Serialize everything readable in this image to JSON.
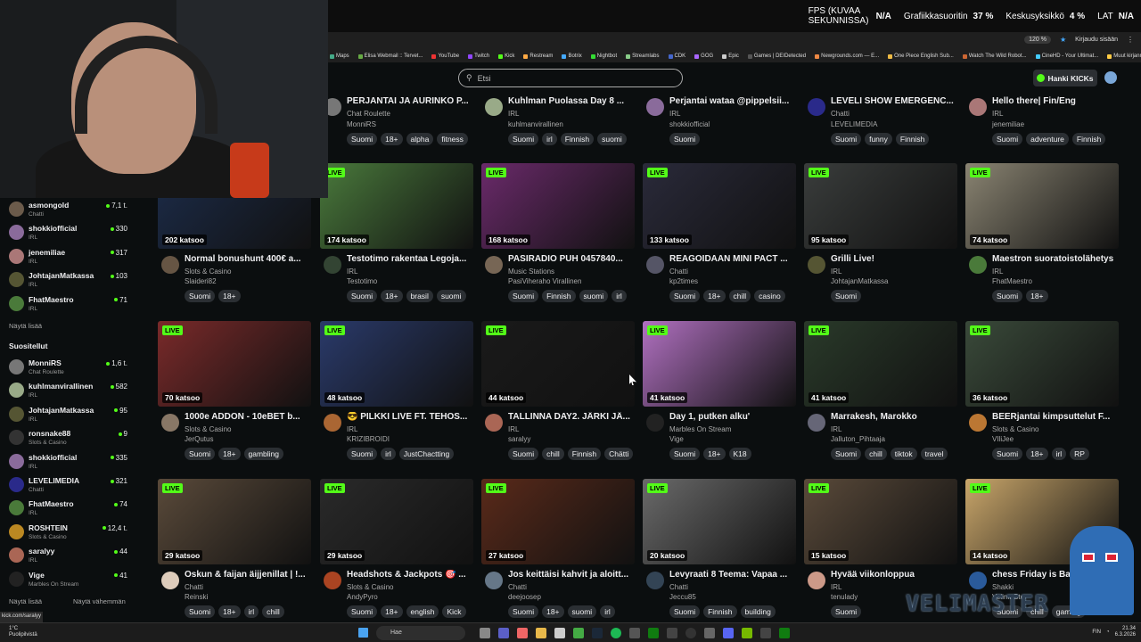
{
  "overlay": {
    "fps_label": "FPS (KUVAA SEKUNNISSA)",
    "fps_value": "N/A",
    "gpu_label": "Grafiikkasuoritin",
    "gpu_value": "37 %",
    "cpu_label": "Keskusyksikkö",
    "cpu_value": "4 %",
    "lat_label": "LAT",
    "lat_value": "N/A"
  },
  "browser": {
    "zoom": "120 %",
    "signin": "Kirjaudu sisään",
    "bookmarks": [
      "Maps",
      "Elisa Webmail :: Tervet...",
      "YouTube",
      "Twitch",
      "Kick",
      "Restream",
      "Botrix",
      "Nightbot",
      "Streamlabs",
      "CDK",
      "GOG",
      "Epic",
      "Games | DEIDetected",
      "Newgrounds.com — E...",
      "One Piece English Sub...",
      "Watch The Wild Robot...",
      "CineHD - Your Ultimat...",
      "Muut kirjanmerkit"
    ]
  },
  "header": {
    "search_placeholder": "Etsi",
    "kicks_button": "Hanki KICKs"
  },
  "sidebar": {
    "followed": [
      {
        "name": "asmongold",
        "cat": "Chatti",
        "views": "7,1 t.",
        "color": "#6b5b4b"
      },
      {
        "name": "shokkiofficial",
        "cat": "IRL",
        "views": "330",
        "color": "#8a6b9b"
      },
      {
        "name": "jenemiliae",
        "cat": "IRL",
        "views": "317",
        "color": "#a77"
      },
      {
        "name": "JohtajanMatkassa",
        "cat": "IRL",
        "views": "103",
        "color": "#553"
      },
      {
        "name": "FhatMaestro",
        "cat": "IRL",
        "views": "71",
        "color": "#4a7a3a"
      }
    ],
    "show_more": "Näytä lisää",
    "recommended_title": "Suositellut",
    "recommended": [
      {
        "name": "MonniRS",
        "cat": "Chat Roulette",
        "views": "1,6 t.",
        "color": "#777"
      },
      {
        "name": "kuhlmanvirallinen",
        "cat": "IRL",
        "views": "582",
        "color": "#9a8"
      },
      {
        "name": "JohtajanMatkassa",
        "cat": "IRL",
        "views": "95",
        "color": "#553"
      },
      {
        "name": "ronsnake88",
        "cat": "Slots & Casino",
        "views": "9",
        "color": "#333"
      },
      {
        "name": "shokkiofficial",
        "cat": "IRL",
        "views": "335",
        "color": "#8a6b9b"
      },
      {
        "name": "LEVELIMEDIA",
        "cat": "Chatti",
        "views": "321",
        "color": "#2a2a8a"
      },
      {
        "name": "FhatMaestro",
        "cat": "IRL",
        "views": "74",
        "color": "#4a7a3a"
      },
      {
        "name": "ROSHTEIN",
        "cat": "Slots & Casino",
        "views": "12,4 t.",
        "color": "#b82"
      },
      {
        "name": "saralyy",
        "cat": "IRL",
        "views": "44",
        "color": "#a65"
      },
      {
        "name": "Vige",
        "cat": "Marbles On Stream",
        "views": "41",
        "color": "#222"
      }
    ],
    "show_more2": "Näytä lisää",
    "show_less": "Näytä vähemmän",
    "status_url": "kick.com/saralyy"
  },
  "top_row": [
    {
      "title": "PERJANTAI JA AURINKO P...",
      "cat": "Chat Roulette",
      "user": "MonniRS",
      "tags": [
        "Suomi",
        "18+",
        "alpha",
        "fitness"
      ],
      "color": "#777"
    },
    {
      "title": "Kuhlman Puolassa Day 8 ...",
      "cat": "IRL",
      "user": "kuhlmanvirallinen",
      "tags": [
        "Suomi",
        "irl",
        "Finnish",
        "suomi"
      ],
      "color": "#9a8"
    },
    {
      "title": "Perjantai wataa @pippelsii...",
      "cat": "IRL",
      "user": "shokkiofficial",
      "tags": [
        "Suomi"
      ],
      "color": "#8a6b9b"
    },
    {
      "title": "LEVELI SHOW EMERGENC...",
      "cat": "Chatti",
      "user": "LEVELIMEDIA",
      "tags": [
        "Suomi",
        "funny",
        "Finnish"
      ],
      "color": "#2a2a8a"
    },
    {
      "title": "Hello there| Fin/Eng",
      "cat": "IRL",
      "user": "jenemiliae",
      "tags": [
        "Suomi",
        "adventure",
        "Finnish"
      ],
      "color": "#a77"
    }
  ],
  "rows": [
    [
      {
        "views": "202 katsoo",
        "title": "Normal bonushunt 400€ a...",
        "cat": "Slots & Casino",
        "user": "Slaideri82",
        "tags": [
          "Suomi",
          "18+"
        ],
        "bg": "#1c2c4a",
        "color": "#654"
      },
      {
        "views": "174 katsoo",
        "title": "Testotimo rakentaa Legoja...",
        "cat": "IRL",
        "user": "Testotimo",
        "tags": [
          "Suomi",
          "18+",
          "brasil",
          "suomi"
        ],
        "bg": "#4a7a3c",
        "color": "#343"
      },
      {
        "views": "168 katsoo",
        "title": "PASIRADIO PUH 0457840...",
        "cat": "Music Stations",
        "user": "PasiViheraho Virallinen",
        "tags": [
          "Suomi",
          "Finnish",
          "suomi",
          "irl"
        ],
        "bg": "#6a2a6a",
        "color": "#765"
      },
      {
        "views": "133 katsoo",
        "title": "REAGOIDAAN MINI PACT ...",
        "cat": "Chatti",
        "user": "kp2times",
        "tags": [
          "Suomi",
          "18+",
          "chill",
          "casino"
        ],
        "bg": "#2a2a3a",
        "color": "#556"
      },
      {
        "views": "95 katsoo",
        "title": "Grilli Live!",
        "cat": "IRL",
        "user": "JohtajanMatkassa",
        "tags": [
          "Suomi"
        ],
        "bg": "#3a3d3c",
        "color": "#553"
      },
      {
        "views": "74 katsoo",
        "title": "Maestron suoratoistolähetys",
        "cat": "IRL",
        "user": "FhatMaestro",
        "tags": [
          "Suomi",
          "18+"
        ],
        "bg": "#8a8472",
        "color": "#4a7a3a"
      }
    ],
    [
      {
        "views": "70 katsoo",
        "title": "1000e ADDON - 10eBET b...",
        "cat": "Slots & Casino",
        "user": "JerQutus",
        "tags": [
          "Suomi",
          "18+",
          "gambling"
        ],
        "bg": "#7a2a2a",
        "color": "#876"
      },
      {
        "views": "48 katsoo",
        "title": "😎 PILKKI LIVE FT. TEHOS...",
        "cat": "IRL",
        "user": "KRIZIBROIDI",
        "tags": [
          "Suomi",
          "irl",
          "JustChactting"
        ],
        "bg": "#2a3a6a",
        "color": "#a63"
      },
      {
        "views": "44 katsoo",
        "title": "TALLINNA DAY2. JÄRKI JÄ...",
        "cat": "IRL",
        "user": "saralyy",
        "tags": [
          "Suomi",
          "chill",
          "Finnish",
          "Chätti"
        ],
        "bg": "#1a1a1a",
        "color": "#a65"
      },
      {
        "views": "41 katsoo",
        "title": "Day 1, putken alku'",
        "cat": "Marbles On Stream",
        "user": "Vige",
        "tags": [
          "Suomi",
          "18+",
          "K18"
        ],
        "bg": "#b070c0",
        "color": "#222"
      },
      {
        "views": "41 katsoo",
        "title": "Marrakesh, Marokko",
        "cat": "IRL",
        "user": "Jalluton_Pihtaaja",
        "tags": [
          "Suomi",
          "chill",
          "tiktok",
          "travel"
        ],
        "bg": "#2a3a2a",
        "color": "#667"
      },
      {
        "views": "36 katsoo",
        "title": "BEERjantai kimpsuttelut F...",
        "cat": "Slots & Casino",
        "user": "VIliJee",
        "tags": [
          "Suomi",
          "18+",
          "irl",
          "RP"
        ],
        "bg": "#3a4a3a",
        "color": "#b73"
      }
    ],
    [
      {
        "views": "29 katsoo",
        "title": "Oskun & faijan äijjenillat | !...",
        "cat": "Chatti",
        "user": "Reinski",
        "tags": [
          "Suomi",
          "18+",
          "irl",
          "chill"
        ],
        "bg": "#5a4a3a",
        "color": "#dcb"
      },
      {
        "views": "29 katsoo",
        "title": "Headshots & Jackpots 🎯 ...",
        "cat": "Slots & Casino",
        "user": "AndyPyro",
        "tags": [
          "Suomi",
          "18+",
          "english",
          "Kick"
        ],
        "bg": "#2a2a2a",
        "color": "#a42"
      },
      {
        "views": "27 katsoo",
        "title": "Jos keittäisi kahvit ja aloitt...",
        "cat": "Chatti",
        "user": "deejoosep",
        "tags": [
          "Suomi",
          "18+",
          "suomi",
          "irl"
        ],
        "bg": "#5a2a1a",
        "color": "#678"
      },
      {
        "views": "20 katsoo",
        "title": "Levyraati 8 Teema: Vapaa ...",
        "cat": "Chatti",
        "user": "Jeccu85",
        "tags": [
          "Suomi",
          "Finnish",
          "building"
        ],
        "bg": "#6a6a6a",
        "color": "#345"
      },
      {
        "views": "15 katsoo",
        "title": "Hyvää viikonloppua",
        "cat": "IRL",
        "user": "tenulady",
        "tags": [
          "Suomi"
        ],
        "bg": "#5a4a3a",
        "color": "#c98"
      },
      {
        "views": "14 katsoo",
        "title": "chess Friday is Back",
        "cat": "Shakki",
        "user": "VelimaSter",
        "tags": [
          "Suomi",
          "chill",
          "gaming"
        ],
        "bg": "#c9a66a",
        "color": "#2a5a9a"
      }
    ]
  ],
  "live_label": "LIVE",
  "taskbar": {
    "weather_temp": "1°C",
    "weather_text": "Puolipilvistä",
    "search": "Hae",
    "lang": "FIN",
    "time": "21.34",
    "date": "6.3.2026"
  },
  "watermark": "VELIMASTER"
}
